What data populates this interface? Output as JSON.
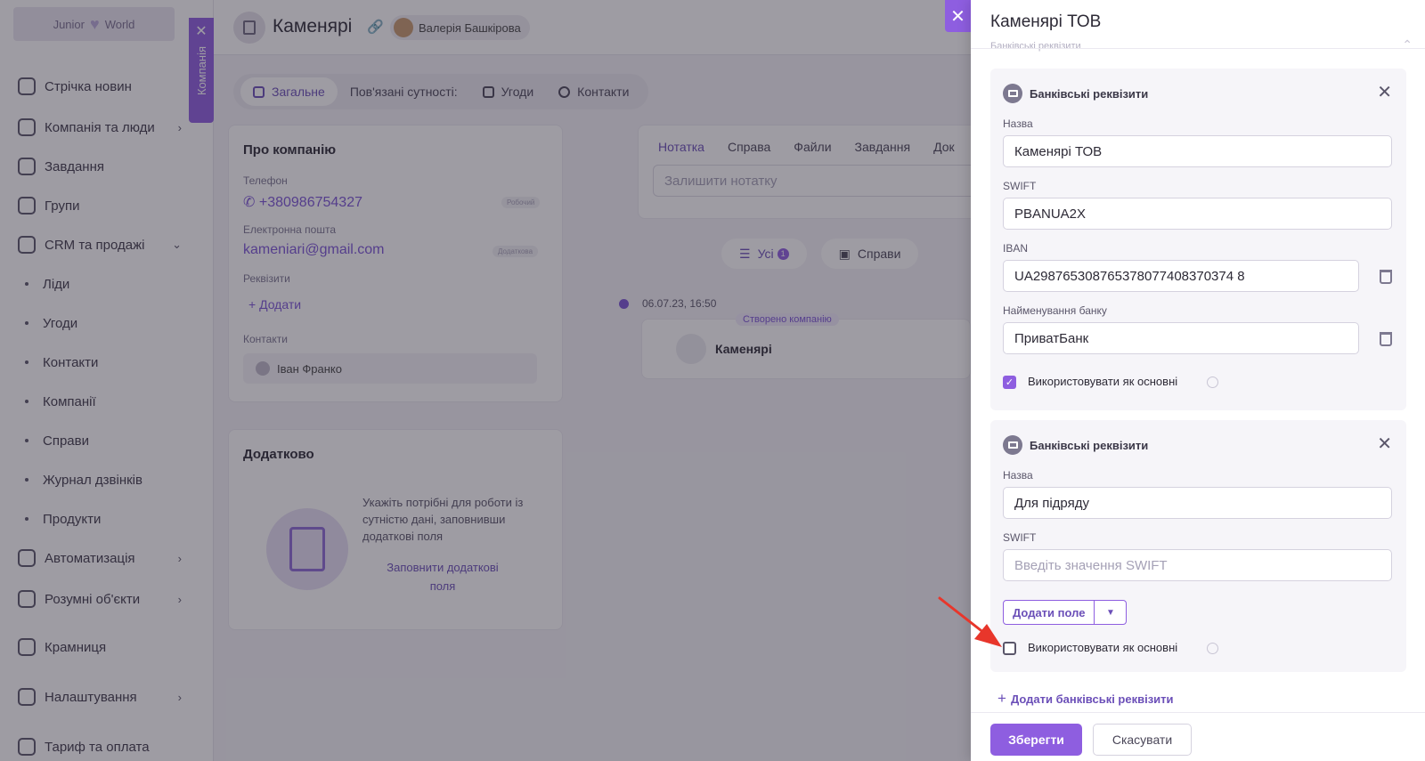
{
  "sidebar": {
    "logo": "Junior",
    "logo_right": "World",
    "items": [
      {
        "label": "Стрічка новин",
        "sub": false,
        "chevron": ""
      },
      {
        "label": "Компанія та люди",
        "sub": false,
        "chevron": "›"
      },
      {
        "label": "Завдання",
        "sub": false,
        "chevron": ""
      },
      {
        "label": "Групи",
        "sub": false,
        "chevron": ""
      },
      {
        "label": "CRM та продажі",
        "sub": false,
        "chevron": "⌄"
      },
      {
        "label": "Ліди",
        "sub": true,
        "chevron": ""
      },
      {
        "label": "Угоди",
        "sub": true,
        "chevron": ""
      },
      {
        "label": "Контакти",
        "sub": true,
        "chevron": ""
      },
      {
        "label": "Компанії",
        "sub": true,
        "chevron": ""
      },
      {
        "label": "Справи",
        "sub": true,
        "chevron": ""
      },
      {
        "label": "Журнал дзвінків",
        "sub": true,
        "chevron": ""
      },
      {
        "label": "Продукти",
        "sub": true,
        "chevron": ""
      },
      {
        "label": "Автоматизація",
        "sub": false,
        "chevron": "›"
      },
      {
        "label": "Розумні об'єкти",
        "sub": false,
        "chevron": "›"
      },
      {
        "label": "Крамниця",
        "sub": false,
        "chevron": ""
      },
      {
        "label": "Налаштування",
        "sub": false,
        "chevron": "›"
      },
      {
        "label": "Тариф та оплата",
        "sub": false,
        "chevron": ""
      }
    ],
    "company_tab": "Компанія",
    "company_tab_close": "✕"
  },
  "header": {
    "title": "Каменярі",
    "link_icon": "link-icon",
    "user": "Валерія Башкірова"
  },
  "tabs": [
    {
      "label": "Загальне",
      "active": true
    },
    {
      "label": "Пов'язані сутності:",
      "active": false
    },
    {
      "label": "Угоди",
      "active": false
    },
    {
      "label": "Контакти",
      "active": false
    }
  ],
  "about": {
    "title": "Про компанію",
    "phone_label": "Телефон",
    "phone": "+380986754327",
    "phone_tag": "Робочий",
    "email_label": "Електронна пошта",
    "email": "kameniari@gmail.com",
    "email_tag": "Додаткова",
    "requisites_label": "Реквізити",
    "add_label": "+ Додати",
    "contacts_label": "Контакти",
    "contact": "Іван Франко"
  },
  "extra": {
    "title": "Додатково",
    "text": "Укажіть потрібні для роботи із сутністю дані, заповнивши додаткові поля",
    "link": "Заповнити додаткові поля"
  },
  "activity": {
    "tabs": [
      "Нотатка",
      "Справа",
      "Файли",
      "Завдання",
      "Док"
    ],
    "note_placeholder": "Залишити нотатку",
    "feed_tabs": [
      {
        "label": "Усі",
        "badge": "1"
      },
      {
        "label": "Справи",
        "badge": ""
      }
    ],
    "date": "06.07.23, 16:50",
    "tag": "Створено компанію",
    "entry": "Каменярі"
  },
  "panel": {
    "close": "✕",
    "title": "Каменярі ТОВ",
    "cut_label": "Банківські реквізити",
    "blocks": [
      {
        "title": "Банківські реквізити",
        "name_label": "Назва",
        "name": "Каменярі ТОВ",
        "swift_label": "SWIFT",
        "swift": "PBANUA2X",
        "iban_label": "IBAN",
        "iban": "UA298765308765378077408370374 8",
        "bank_label": "Найменування банку",
        "bank": "ПриватБанк",
        "primary_label": "Використовувати як основні",
        "primary_checked": true
      },
      {
        "title": "Банківські реквізити",
        "name_label": "Назва",
        "name": "Для підряду",
        "swift_label": "SWIFT",
        "swift_placeholder": "Введіть значення  SWIFT",
        "add_field": "Додати поле",
        "add_field_dd": "▼",
        "primary_label": "Використовувати як основні",
        "primary_checked": false
      }
    ],
    "add_requisites": "Додати банківські реквізити",
    "add_plus": "+",
    "save": "Зберегти",
    "cancel": "Скасувати"
  },
  "colors": {
    "accent": "#8e5ee0",
    "arrow": "#e8362b"
  }
}
